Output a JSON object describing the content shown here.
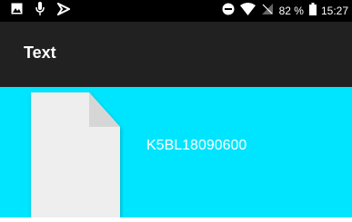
{
  "status_bar": {
    "left_icons": [
      "image-icon",
      "microphone-icon",
      "cast-icon"
    ],
    "right_icons": [
      "do-not-disturb-icon",
      "wifi-icon",
      "no-signal-icon",
      "battery-icon"
    ],
    "battery_percent": "82 %",
    "time": "15:27"
  },
  "toolbar": {
    "title": "Text",
    "background": "#212121"
  },
  "content": {
    "background": "#00e5ff",
    "file": {
      "icon": "document-icon",
      "name": "K5BL18090600"
    }
  }
}
